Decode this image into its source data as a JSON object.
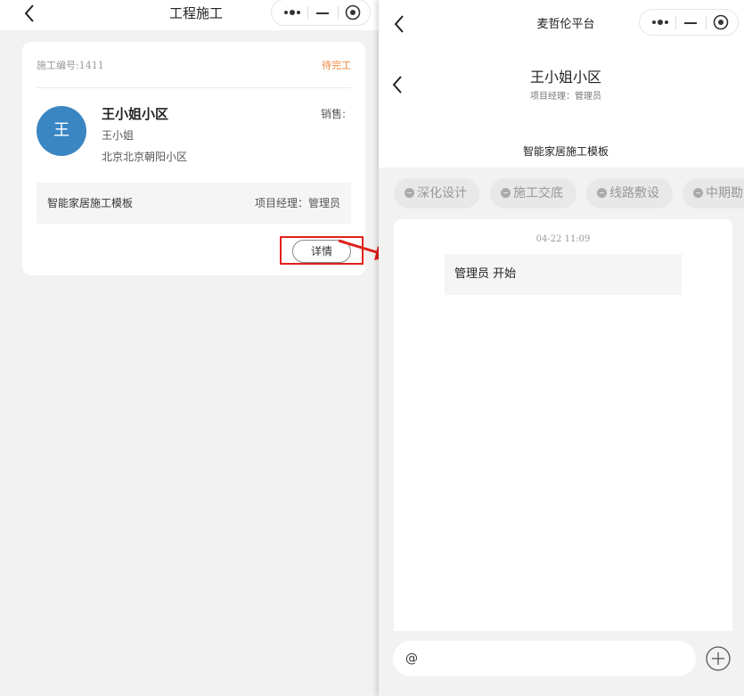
{
  "left": {
    "title": "工程施工",
    "card": {
      "number": "施工编号:1411",
      "status": "待完工",
      "avatar": "王",
      "customer_name": "王小姐小区",
      "contact": "王小姐",
      "address": "北京北京朝阳小区",
      "sales_label": "销售:",
      "template_name": "智能家居施工模板",
      "project_manager": "项目经理：管理员",
      "detail_button": "详情"
    }
  },
  "right": {
    "title": "麦哲伦平台",
    "project_name": "王小姐小区",
    "project_manager": "项目经理：管理员",
    "template_title": "智能家居施工模板",
    "stages": [
      "深化设计",
      "施工交底",
      "线路敷设",
      "中期勘"
    ],
    "log": {
      "time": "04-22 11:09",
      "message": "管理员 开始"
    },
    "input_value": "@"
  },
  "colors": {
    "status_orange": "#f0883a",
    "avatar_blue": "#3a86c3",
    "highlight_red": "#e0201b"
  },
  "icons": [
    "back-icon",
    "more-dots-icon",
    "minimize-icon",
    "close-target-icon",
    "stage-dot-icon",
    "add-circle-icon",
    "arrow-annotation"
  ]
}
